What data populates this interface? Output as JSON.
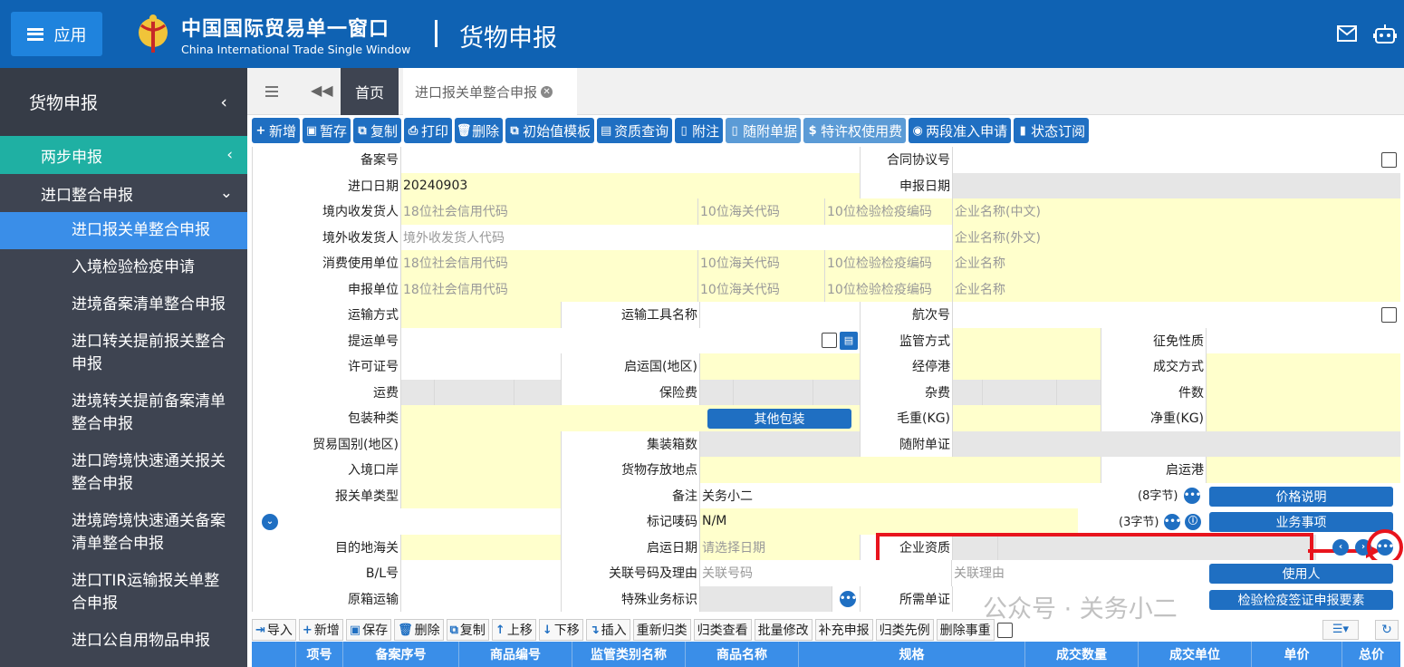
{
  "header": {
    "app_label": "应用",
    "brand_cn": "中国国际贸易单一窗口",
    "brand_en": "China International Trade Single Window",
    "title": "货物申报"
  },
  "sidebar": {
    "top_label": "货物申报",
    "items": [
      {
        "label": "两步申报"
      },
      {
        "label": "进口整合申报"
      }
    ],
    "subitems": [
      "进口报关单整合申报",
      "入境检验检疫申请",
      "进境备案清单整合申报",
      "进口转关提前报关整合申报",
      "进境转关提前备案清单整合申报",
      "进口跨境快速通关报关整合申报",
      "进境跨境快速通关备案清单整合申报",
      "进口TIR运输报关单整合申报",
      "进口公自用物品申报"
    ]
  },
  "tabs": {
    "home": "首页",
    "active": "进口报关单整合申报"
  },
  "toolbar": [
    "新增",
    "暂存",
    "复制",
    "打印",
    "删除",
    "初始值模板",
    "资质查询",
    "附注",
    "随附单据",
    "特许权使用费",
    "两段准入申请",
    "状态订阅"
  ],
  "form": {
    "labels": {
      "beian": "备案号",
      "hetong": "合同协议号",
      "jkrq": "进口日期",
      "sbrq": "申报日期",
      "jnsfh": "境内收发货人",
      "jwsfh": "境外收发货人",
      "xfsy": "消费使用单位",
      "sbdw": "申报单位",
      "ysfs": "运输方式",
      "ysgj": "运输工具名称",
      "hch": "航次号",
      "tydh": "提运单号",
      "jgfs": "监管方式",
      "zmxz": "征免性质",
      "xkzh": "许可证号",
      "qyg": "启运国(地区)",
      "jtg": "经停港",
      "cjfs": "成交方式",
      "yf": "运费",
      "bxf": "保险费",
      "zf": "杂费",
      "js": "件数",
      "bzzl": "包装种类",
      "mz": "毛重(KG)",
      "jz": "净重(KG)",
      "mygb": "贸易国别(地区)",
      "jzxs": "集装箱数",
      "sfdz": "随附单证",
      "rjka": "入境口岸",
      "hwcf": "货物存放地点",
      "qyg2": "启运港",
      "bgdlx": "报关单类型",
      "bz": "备注",
      "bjmt": "标记唛码",
      "mddhg": "目的地海关",
      "qyrq": "启运日期",
      "qyzz": "企业资质",
      "bl": "B/L号",
      "glhm": "关联号码及理由",
      "yxys": "原箱运输",
      "tsyw": "特殊业务标识",
      "sxdz": "所需单证"
    },
    "values": {
      "jkrq": "20240903",
      "bz": "关务小二",
      "bjmt": "N/M",
      "bz_count": "(8字节)",
      "bjmt_count": "(3字节)"
    },
    "placeholders": {
      "xydm": "18位社会信用代码",
      "hgdm": "10位海关代码",
      "jyjy": "10位检验检疫编码",
      "qymc_cn": "企业名称(中文)",
      "jwdm": "境外收发货人代码",
      "qymc_wai": "企业名称(外文)",
      "qymc": "企业名称",
      "date": "请选择日期",
      "glhm": "关联号码",
      "glly": "关联理由"
    },
    "buttons": {
      "other_pack": "其他包装",
      "price": "价格说明",
      "biz": "业务事项",
      "user": "使用人",
      "inspect": "检验检疫签证申报要素"
    }
  },
  "bottom_toolbar": [
    "导入",
    "新增",
    "保存",
    "删除",
    "复制",
    "上移",
    "下移",
    "插入",
    "重新归类",
    "归类查看",
    "批量修改",
    "补充申报",
    "归类先例",
    "删除事重"
  ],
  "table_headers": [
    "项号",
    "备案序号",
    "商品编号",
    "监管类别名称",
    "商品名称",
    "规格",
    "成交数量",
    "成交单位",
    "单价",
    "总价"
  ],
  "watermark": "公众号 · 关务小二"
}
